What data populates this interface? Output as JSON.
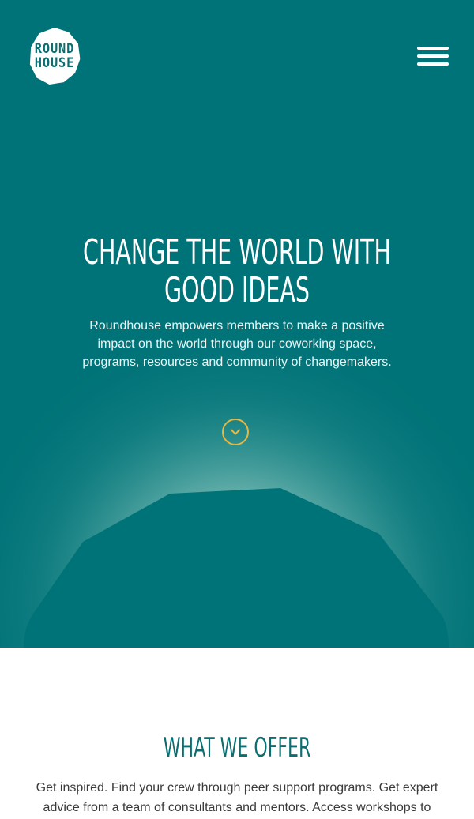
{
  "header": {
    "logo_line1": "ROUND",
    "logo_line2": "HOUSE",
    "menu_icon": "hamburger-menu-icon"
  },
  "hero": {
    "title": "CHANGE THE WORLD WITH GOOD IDEAS",
    "text": "Roundhouse empowers members to make a positive impact on the world through our coworking space, programs, resources and community of changemakers.",
    "scroll_icon": "chevron-down-icon"
  },
  "offer": {
    "title": "WHAT WE OFFER",
    "text": "Get inspired. Find your crew through peer support programs. Get expert advice from a team of consultants and mentors. Access workshops to"
  },
  "colors": {
    "hero_background": "#007378",
    "accent": "#eab63c",
    "heading_teal": "#0b6f72"
  }
}
